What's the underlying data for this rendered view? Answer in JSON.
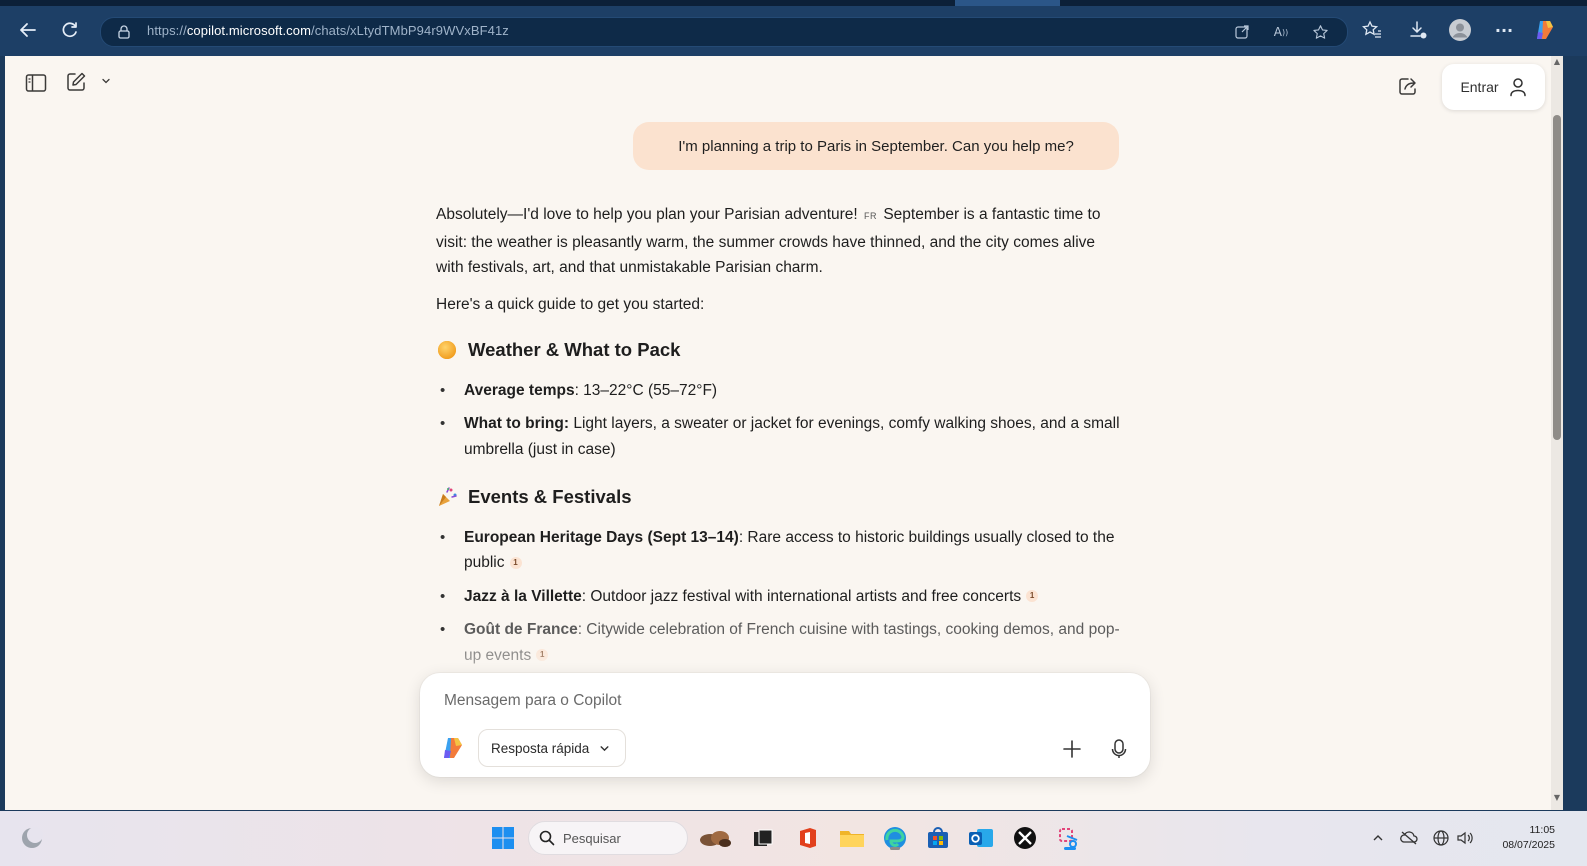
{
  "browser": {
    "url_prefix": "https://",
    "url_domain": "copilot.microsoft.com",
    "url_path": "/chats/xLtydTMbP94r9WVxBF41z"
  },
  "header": {
    "signin_label": "Entrar"
  },
  "chat": {
    "user_message": "I'm planning a trip to Paris in September. Can you help me?",
    "intro_part1": "Absolutely—I'd love to help you plan your Parisian adventure!",
    "intro_flag": "FR",
    "intro_part2": "September is a fantastic time to visit: the weather is pleasantly warm, the summer crowds have thinned, and the city comes alive with festivals, art, and that unmistakable Parisian charm.",
    "guide_intro": "Here's a quick guide to get you started:",
    "sections": [
      {
        "title": "Weather & What to Pack",
        "items": [
          {
            "label": "Average temps",
            "text": ": 13–22°C (55–72°F)",
            "cite": ""
          },
          {
            "label": "What to bring:",
            "text": " Light layers, a sweater or jacket for evenings, comfy walking shoes, and a small umbrella (just in case)",
            "cite": ""
          }
        ]
      },
      {
        "title": "Events & Festivals",
        "items": [
          {
            "label": "European Heritage Days (Sept 13–14)",
            "text": ": Rare access to historic buildings usually closed to the public",
            "cite": "1"
          },
          {
            "label": "Jazz à la Villette",
            "text": ": Outdoor jazz festival with international artists and free concerts",
            "cite": "1"
          },
          {
            "label": "Goût de France",
            "text": ": Citywide celebration of French cuisine with tastings, cooking demos, and pop-up events",
            "cite": "1"
          }
        ]
      }
    ]
  },
  "composer": {
    "placeholder": "Mensagem para o Copilot",
    "mode_label": "Resposta rápida"
  },
  "taskbar": {
    "search_placeholder": "Pesquisar",
    "time": "11:05",
    "date": "08/07/2025"
  },
  "colors": {
    "browser_bar": "#1d3f66",
    "page_bg": "#faf6f1",
    "user_bubble": "#fbe2cf"
  }
}
